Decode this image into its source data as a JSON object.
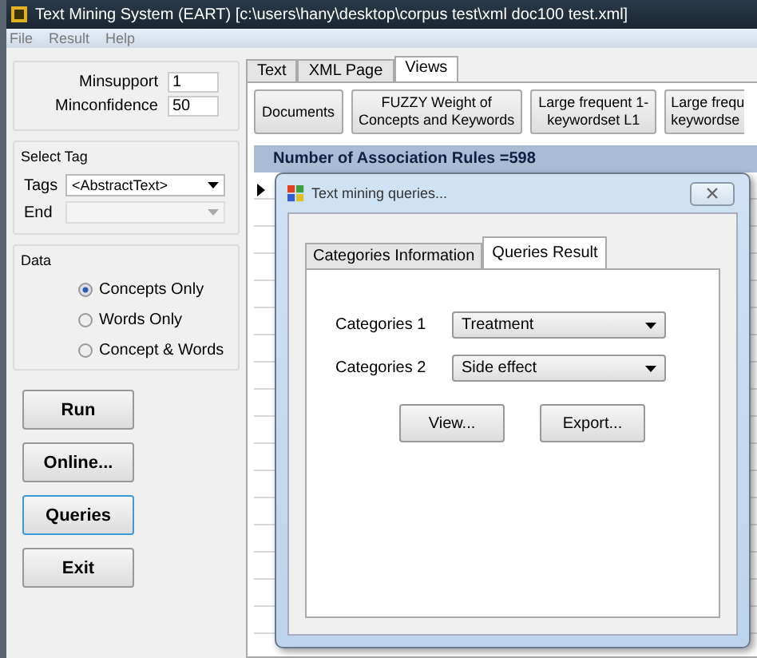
{
  "window": {
    "title": "Text Mining System (EART) [c:\\users\\hany\\desktop\\corpus test\\xml doc100 test.xml]"
  },
  "menu": [
    "File",
    "Result",
    "Help"
  ],
  "thresholds": [
    {
      "label": "Minsupport",
      "value": "1"
    },
    {
      "label": "Minconfidence",
      "value": "50"
    }
  ],
  "select_tag": {
    "title": "Select Tag",
    "fields": [
      {
        "label": "Tags",
        "value": "<AbstractText>",
        "disabled": false
      },
      {
        "label": "End",
        "disabled": true
      }
    ]
  },
  "data": {
    "title": "Data",
    "options": [
      {
        "label": "Concepts Only",
        "selected": true
      },
      {
        "label": "Words Only",
        "selected": false
      },
      {
        "label": "Concept & Words",
        "selected": false
      }
    ]
  },
  "actions": [
    {
      "label": "Run",
      "focused": false
    },
    {
      "label": "Online...",
      "focused": false
    },
    {
      "label": "Queries",
      "focused": true
    },
    {
      "label": "Exit",
      "focused": false
    }
  ],
  "tabs": [
    {
      "label": "Text",
      "selected": false
    },
    {
      "label": "XML Page",
      "selected": false
    },
    {
      "label": "Views",
      "selected": true
    }
  ],
  "view_buttons": [
    {
      "lines": [
        "Documents"
      ]
    },
    {
      "lines": [
        "FUZZY Weight of",
        "Concepts and  Keywords"
      ]
    },
    {
      "lines": [
        "Large frequent 1-",
        "keywordset L1"
      ]
    },
    {
      "lines": [
        "Large frequ",
        "keywordse"
      ]
    }
  ],
  "rules_header": "Number of Association Rules =598",
  "dialog": {
    "title": "Text mining queries...",
    "tabs": [
      {
        "label": "Categories Information",
        "selected": false
      },
      {
        "label": "Queries Result",
        "selected": true
      }
    ],
    "fields": [
      {
        "label": "Categories 1",
        "value": "Treatment"
      },
      {
        "label": "Categories 2",
        "value": "Side effect"
      }
    ],
    "buttons": [
      "View...",
      "Export..."
    ]
  }
}
